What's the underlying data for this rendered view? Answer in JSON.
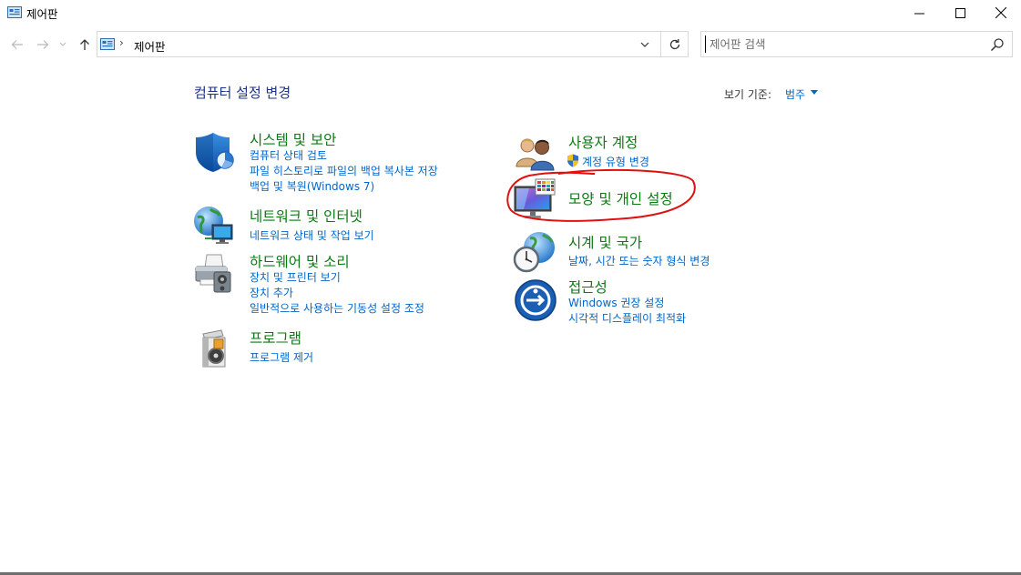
{
  "window": {
    "title": "제어판"
  },
  "address": {
    "separator": "›",
    "crumb": "제어판"
  },
  "search": {
    "placeholder": "제어판 검색"
  },
  "header": {
    "title": "컴퓨터 설정 변경",
    "view_by_label": "보기 기준:",
    "view_by_value": "범주"
  },
  "categories": [
    {
      "title": "시스템 및 보안",
      "icon": "shield-icon",
      "links": [
        "컴퓨터 상태 검토",
        "파일 히스토리로 파일의 백업 복사본 저장",
        "백업 및 복원(Windows 7)"
      ]
    },
    {
      "title": "네트워크 및 인터넷",
      "icon": "network-icon",
      "links": [
        "네트워크 상태 및 작업 보기"
      ]
    },
    {
      "title": "하드웨어 및 소리",
      "icon": "printer-icon",
      "links": [
        "장치 및 프린터 보기",
        "장치 추가",
        "일반적으로 사용하는 기동성 설정 조정"
      ]
    },
    {
      "title": "프로그램",
      "icon": "programs-icon",
      "links": [
        "프로그램 제거"
      ]
    },
    {
      "title": "사용자 계정",
      "icon": "users-icon",
      "links": [
        "계정 유형 변경"
      ]
    },
    {
      "title": "모양 및 개인 설정",
      "icon": "appearance-icon",
      "links": []
    },
    {
      "title": "시계 및 국가",
      "icon": "clock-globe-icon",
      "links": [
        "날짜, 시간 또는 숫자 형식 변경"
      ]
    },
    {
      "title": "접근성",
      "icon": "accessibility-icon",
      "links": [
        "Windows 권장 설정",
        "시각적 디스플레이 최적화"
      ]
    }
  ],
  "colors": {
    "category_title": "#0a7a12",
    "link": "#0066cc",
    "page_title": "#1e3287",
    "annotation": "#e01010"
  }
}
